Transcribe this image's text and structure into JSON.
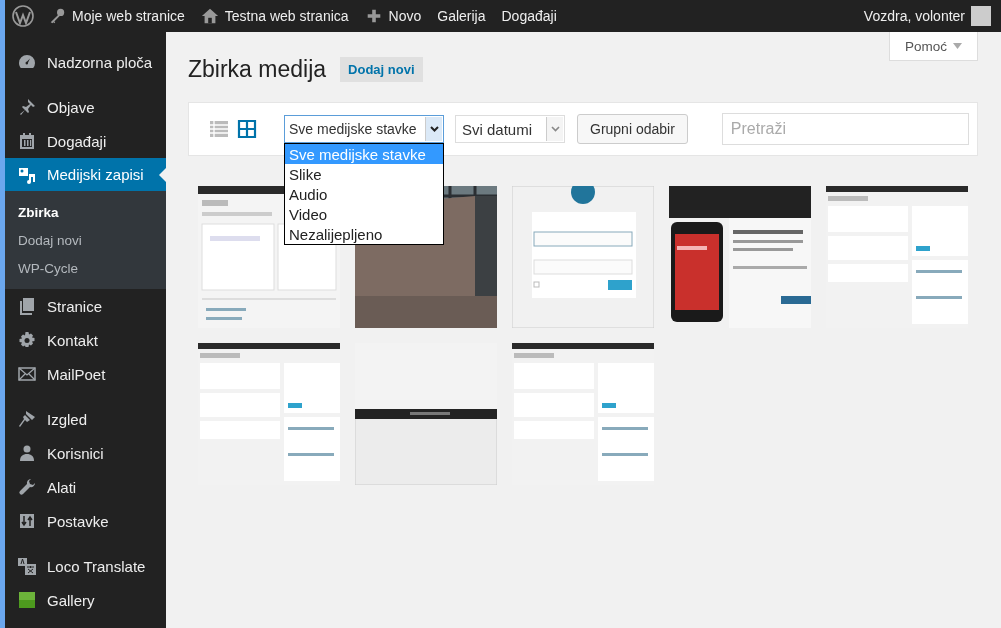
{
  "admin_bar": {
    "items": [
      {
        "kind": "logo"
      },
      {
        "kind": "sites",
        "label": "Moje web stranice"
      },
      {
        "kind": "home",
        "label": "Testna web stranica"
      },
      {
        "kind": "new",
        "label": "Novo"
      },
      {
        "kind": "text",
        "label": "Galerija"
      },
      {
        "kind": "text",
        "label": "Događaji"
      }
    ],
    "user": "Vozdra, volonter"
  },
  "sidebar": {
    "groups": [
      [
        {
          "kind": "dashboard",
          "label": "Nadzorna ploča",
          "selected": false
        }
      ],
      [
        {
          "kind": "pin",
          "label": "Objave",
          "selected": false
        },
        {
          "kind": "calendar",
          "label": "Događaji",
          "selected": false
        },
        {
          "kind": "media",
          "label": "Medijski zapisi",
          "selected": true,
          "children": [
            {
              "label": "Zbirka",
              "selected": true
            },
            {
              "label": "Dodaj novi",
              "selected": false
            },
            {
              "label": "WP-Cycle",
              "selected": false
            }
          ]
        },
        {
          "kind": "pages",
          "label": "Stranice",
          "selected": false
        },
        {
          "kind": "gear",
          "label": "Kontakt",
          "selected": false
        },
        {
          "kind": "envelope",
          "label": "MailPoet",
          "selected": false
        }
      ],
      [
        {
          "kind": "brush",
          "label": "Izgled",
          "selected": false
        },
        {
          "kind": "user",
          "label": "Korisnici",
          "selected": false
        },
        {
          "kind": "wrench",
          "label": "Alati",
          "selected": false
        },
        {
          "kind": "sliders",
          "label": "Postavke",
          "selected": false
        }
      ],
      [
        {
          "kind": "translate",
          "label": "Loco Translate",
          "selected": false
        },
        {
          "kind": "square",
          "label": "Gallery",
          "selected": false
        }
      ]
    ]
  },
  "help_tab": "Pomoć",
  "page": {
    "title": "Zbirka medija",
    "add_button": "Dodaj novi"
  },
  "toolbar": {
    "view_modes": [
      {
        "kind": "list",
        "selected": false
      },
      {
        "kind": "grid",
        "selected": true
      }
    ],
    "type_filter": {
      "value": "Sve medijske stavke",
      "open": true,
      "options": [
        {
          "label": "Sve medijske stavke",
          "selected": true
        },
        {
          "label": "Slike",
          "selected": false
        },
        {
          "label": "Audio",
          "selected": false
        },
        {
          "label": "Video",
          "selected": false
        },
        {
          "label": "Nezalijepljeno",
          "selected": false
        }
      ]
    },
    "date_filter": {
      "value": "Svi datumi"
    },
    "bulk_button": "Grupni odabir",
    "search": {
      "placeholder": "Pretraži"
    }
  }
}
